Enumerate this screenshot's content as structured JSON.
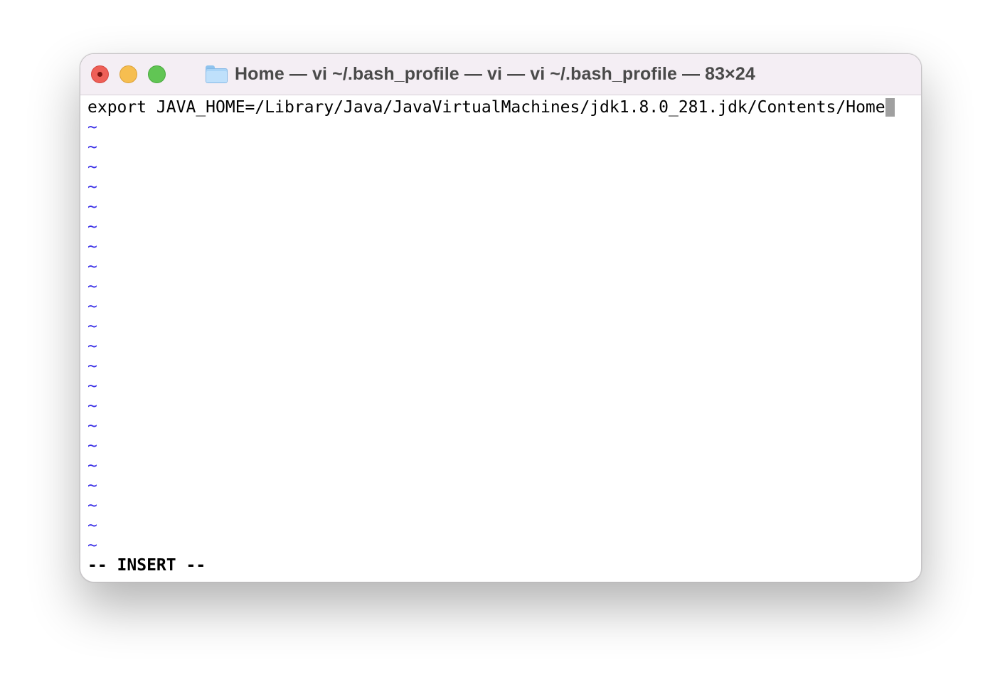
{
  "window": {
    "title": "Home — vi ~/.bash_profile — vi — vi ~/.bash_profile — 83×24",
    "folder_icon": "folder-icon"
  },
  "traffic_lights": {
    "close_color": "#ee5f57",
    "minimize_color": "#f6be50",
    "zoom_color": "#61c554"
  },
  "editor": {
    "first_line": "export JAVA_HOME=/Library/Java/JavaVirtualMachines/jdk1.8.0_281.jdk/Contents/Home",
    "empty_line_marker": "~",
    "empty_line_count": 22,
    "empty_line_color": "#3a2fe6",
    "mode_line": "-- INSERT --"
  }
}
